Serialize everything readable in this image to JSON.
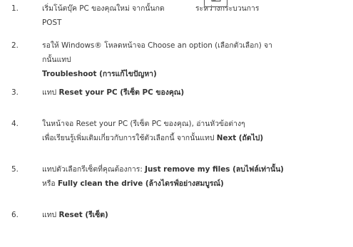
{
  "steps": [
    {
      "num": "1.",
      "line1_pre": "เริ่มโน้ตบุ๊ค PC ของคุณใหม่ จากนั้นกด",
      "line1_post": "ระหว่างกระบวนการ",
      "line2": "POST"
    },
    {
      "num": "2.",
      "line1": "รอให้ Windows® โหลดหน้าจอ Choose an option (เลือกตัวเลือก) จา",
      "line2": "กนั้นแทป",
      "line3_bold": "Troubleshoot (การแก้ไขปัญหา)"
    },
    {
      "num": "3.",
      "pre": "แทป",
      "bold": "Reset your PC (รีเซ็ต PC ของคุณ)"
    },
    {
      "num": "4.",
      "line1": "ในหน้าจอ Reset your PC (รีเซ็ต PC ของคุณ), อ่านหัวข้อต่างๆ",
      "line2_pre": "เพื่อเรียนรู้เพิ่มเติมเกี่ยวกับการใช้ตัวเลือกนี้ จากนั้นแทป",
      "line2_bold": "Next (ถัดไป)"
    },
    {
      "num": "5.",
      "line1_pre": "แทปตัวเลือกรีเซ็ตที่คุณต้องการ:",
      "line1_bold": "Just remove my files (ลบไฟล์เท่านั้น)",
      "line2_pre": "หรือ",
      "line2_bold": "Fully clean the drive (ล้างไดรฟ์อย่างสมบูรณ์)"
    },
    {
      "num": "6.",
      "pre": "แทป",
      "bold": "Reset (รีเซ็ต)"
    }
  ],
  "icons": {
    "key": "keyboard-key-icon"
  }
}
